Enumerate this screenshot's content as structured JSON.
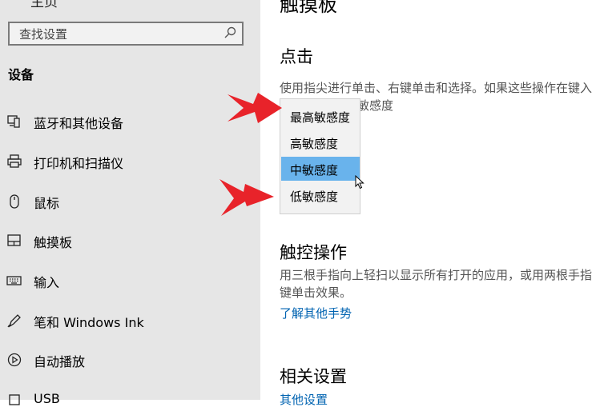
{
  "sidebar": {
    "top_cut_text": "主页",
    "search_placeholder": "查找设置",
    "section_title": "设备",
    "items": [
      {
        "label": "蓝牙和其他设备",
        "icon": "bluetooth-devices-icon"
      },
      {
        "label": "打印机和扫描仪",
        "icon": "printer-icon"
      },
      {
        "label": "鼠标",
        "icon": "mouse-icon"
      },
      {
        "label": "触摸板",
        "icon": "touchpad-icon"
      },
      {
        "label": "输入",
        "icon": "keyboard-icon"
      },
      {
        "label": "笔和 Windows Ink",
        "icon": "pen-icon"
      },
      {
        "label": "自动播放",
        "icon": "autoplay-icon"
      },
      {
        "label": "USB",
        "icon": "usb-icon"
      }
    ]
  },
  "main": {
    "page_title": "触摸板",
    "tap": {
      "title": "点击",
      "desc_line1": "使用指尖进行单击、右键单击和选择。如果这些操作在键入",
      "desc_line2_tail": "敏感度"
    },
    "dropdown": {
      "options": [
        "最高敏感度",
        "高敏感度",
        "中敏感度",
        "低敏感度"
      ],
      "selected": "中敏感度"
    },
    "touch_ops": {
      "title": "触控操作",
      "desc_line1": "用三根手指向上轻扫以显示所有打开的应用，或用两根手指",
      "desc_line2": "键单击效果。",
      "link": "了解其他手势"
    },
    "related": {
      "title": "相关设置",
      "link": "其他设置"
    }
  },
  "colors": {
    "sidebar_bg": "#e6e6e6",
    "selected_option": "#69b3ec",
    "link": "#0063b1",
    "annotation_arrow": "#e8232a"
  }
}
